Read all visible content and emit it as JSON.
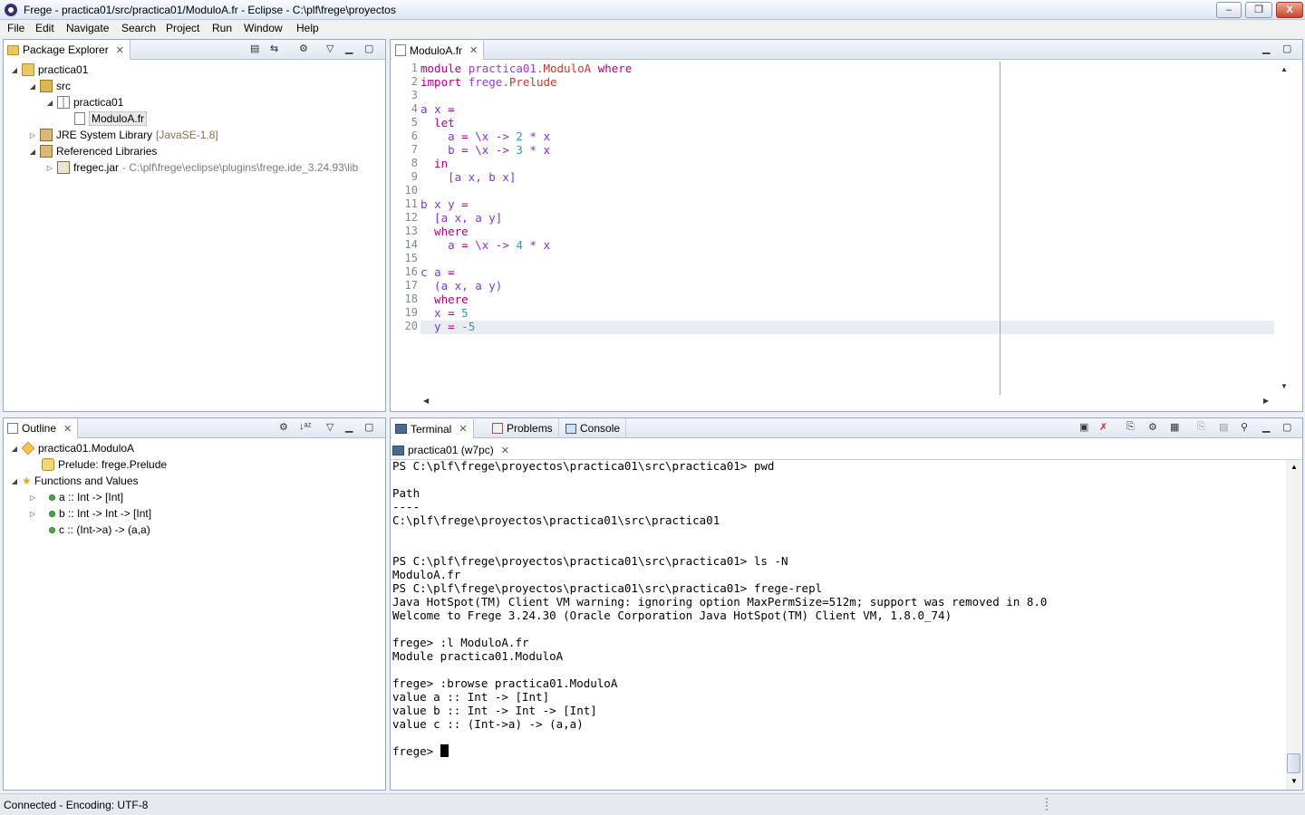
{
  "window": {
    "title": "Frege - practica01/src/practica01/ModuloA.fr - Eclipse - C:\\plf\\frege\\proyectos",
    "minimize": "–",
    "restore": "❐",
    "close": "X"
  },
  "menu": [
    "File",
    "Edit",
    "Navigate",
    "Search",
    "Project",
    "Run",
    "Window",
    "Help"
  ],
  "package_explorer": {
    "tab": "Package Explorer",
    "items": [
      {
        "label": "practica01"
      },
      {
        "label": "src"
      },
      {
        "label": "practica01"
      },
      {
        "label": "ModuloA.fr"
      },
      {
        "label": "JRE System Library",
        "extra": "[JavaSE-1.8]"
      },
      {
        "label": "Referenced Libraries"
      },
      {
        "label": "fregec.jar",
        "extra": "- C:\\plf\\frege\\eclipse\\plugins\\frege.ide_3.24.93\\lib"
      }
    ]
  },
  "outline": {
    "tab": "Outline",
    "items": [
      {
        "label": "practica01.ModuloA"
      },
      {
        "label": "Prelude: frege.Prelude"
      },
      {
        "label": "Functions and Values"
      },
      {
        "label": "a :: Int -> [Int]"
      },
      {
        "label": "b :: Int -> Int -> [Int]"
      },
      {
        "label": "c :: (Int->a) -> (a,a)"
      }
    ]
  },
  "editor": {
    "tab": "ModuloA.fr",
    "line_numbers": [
      "1",
      "2",
      "3",
      "4",
      "5",
      "6",
      "7",
      "8",
      "9",
      "10",
      "11",
      "12",
      "13",
      "14",
      "15",
      "16",
      "17",
      "18",
      "19",
      "20"
    ],
    "lines": [
      [
        {
          "t": "module ",
          "c": "kw"
        },
        {
          "t": "practica01.",
          "c": "nm"
        },
        {
          "t": "ModuloA",
          "c": "mod"
        },
        {
          "t": " where",
          "c": "kw"
        }
      ],
      [
        {
          "t": "import ",
          "c": "kw"
        },
        {
          "t": "frege.",
          "c": "nm"
        },
        {
          "t": "Prelude",
          "c": "mod"
        }
      ],
      [],
      [
        {
          "t": "a ",
          "c": "id"
        },
        {
          "t": "x ",
          "c": "id"
        },
        {
          "t": "=",
          "c": "kw"
        }
      ],
      [
        {
          "t": "  let",
          "c": "kw"
        }
      ],
      [
        {
          "t": "    a ",
          "c": "id"
        },
        {
          "t": "= ",
          "c": "kw"
        },
        {
          "t": "\\x -> ",
          "c": "op"
        },
        {
          "t": "2",
          "c": "num"
        },
        {
          "t": " * x",
          "c": "op"
        }
      ],
      [
        {
          "t": "    b ",
          "c": "id"
        },
        {
          "t": "= ",
          "c": "kw"
        },
        {
          "t": "\\x -> ",
          "c": "op"
        },
        {
          "t": "3",
          "c": "num"
        },
        {
          "t": " * x",
          "c": "op"
        }
      ],
      [
        {
          "t": "  in",
          "c": "kw"
        }
      ],
      [
        {
          "t": "    [a x, b x]",
          "c": "id"
        }
      ],
      [],
      [
        {
          "t": "b ",
          "c": "id"
        },
        {
          "t": "x y ",
          "c": "id"
        },
        {
          "t": "=",
          "c": "kw"
        }
      ],
      [
        {
          "t": "  [a x, a y]",
          "c": "id"
        }
      ],
      [
        {
          "t": "  where",
          "c": "kw"
        }
      ],
      [
        {
          "t": "    a ",
          "c": "id"
        },
        {
          "t": "= ",
          "c": "kw"
        },
        {
          "t": "\\x -> ",
          "c": "op"
        },
        {
          "t": "4",
          "c": "num"
        },
        {
          "t": " * x",
          "c": "op"
        }
      ],
      [],
      [
        {
          "t": "c ",
          "c": "id"
        },
        {
          "t": "a ",
          "c": "id"
        },
        {
          "t": "=",
          "c": "kw"
        }
      ],
      [
        {
          "t": "  (a x, a y)",
          "c": "id"
        }
      ],
      [
        {
          "t": "  where",
          "c": "kw"
        }
      ],
      [
        {
          "t": "  x ",
          "c": "id"
        },
        {
          "t": "= ",
          "c": "kw"
        },
        {
          "t": "5",
          "c": "num"
        }
      ],
      [
        {
          "t": "  y ",
          "c": "id"
        },
        {
          "t": "= ",
          "c": "kw"
        },
        {
          "t": "-5",
          "c": "num"
        }
      ]
    ]
  },
  "bottom_tabs": {
    "terminal": "Terminal",
    "problems": "Problems",
    "console": "Console"
  },
  "terminal": {
    "session_tab": "practica01 (w7pc)",
    "lines": [
      "PS C:\\plf\\frege\\proyectos\\practica01\\src\\practica01> pwd",
      "",
      "Path",
      "----",
      "C:\\plf\\frege\\proyectos\\practica01\\src\\practica01",
      "",
      "",
      "PS C:\\plf\\frege\\proyectos\\practica01\\src\\practica01> ls -N",
      "ModuloA.fr",
      "PS C:\\plf\\frege\\proyectos\\practica01\\src\\practica01> frege-repl",
      "Java HotSpot(TM) Client VM warning: ignoring option MaxPermSize=512m; support was removed in 8.0",
      "Welcome to Frege 3.24.30 (Oracle Corporation Java HotSpot(TM) Client VM, 1.8.0_74)",
      "",
      "frege> :l ModuloA.fr",
      "Module practica01.ModuloA",
      "",
      "frege> :browse practica01.ModuloA",
      "value a :: Int -> [Int]",
      "value b :: Int -> Int -> [Int]",
      "value c :: (Int->a) -> (a,a)",
      "",
      "frege> "
    ]
  },
  "status": "Connected - Encoding: UTF-8"
}
